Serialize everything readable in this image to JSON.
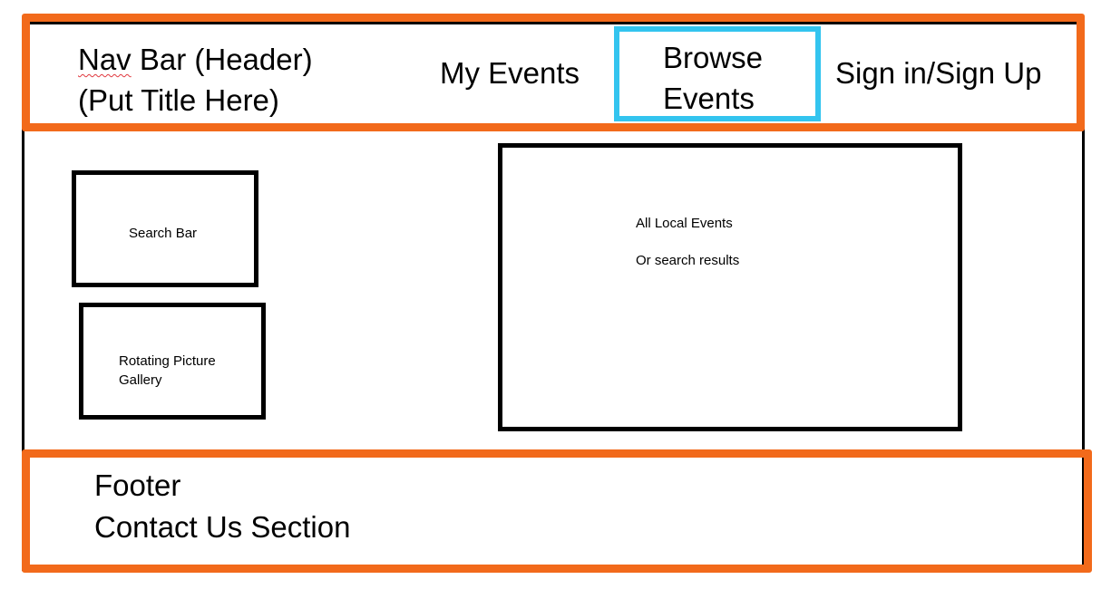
{
  "header": {
    "title_word1": "Nav",
    "title_rest": "  Bar (Header)\n(Put Title Here)",
    "nav": {
      "my_events": "My Events",
      "browse_events": "Browse\nEvents",
      "sign_in": "Sign in/Sign Up"
    },
    "accent_color": "#f26a1b",
    "highlight_color": "#33c4ef"
  },
  "main": {
    "search_bar": "Search Bar",
    "gallery": "Rotating Picture\nGallery",
    "events_line1": "All Local Events",
    "events_line2": "Or search results"
  },
  "footer": {
    "text": "Footer\nContact Us Section"
  }
}
